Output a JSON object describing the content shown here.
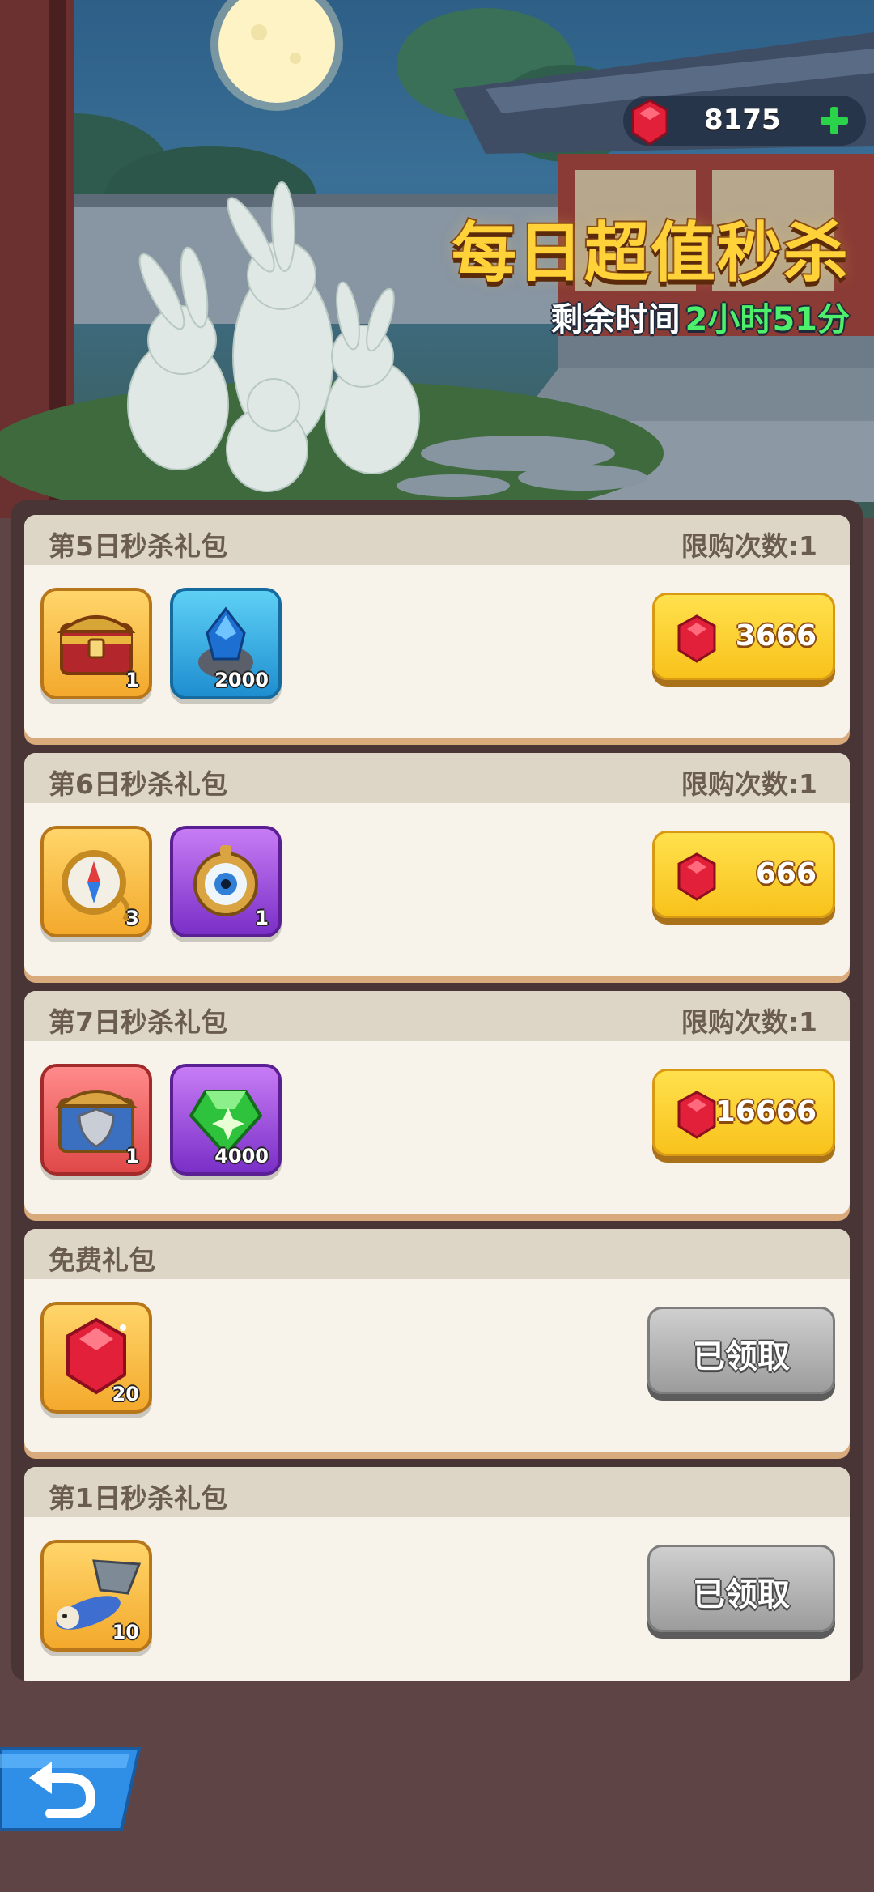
{
  "header": {
    "gem_balance": "8175",
    "title": "每日超值秒杀",
    "timer_label": "剩余时间",
    "timer_value": "2小时51分"
  },
  "colors": {
    "title_gold": "#ffd23a",
    "timer_green": "#4ef06b",
    "buy_yellow": "#f8c21b",
    "claimed_gray": "#9c9c9c",
    "background": "#5e4445"
  },
  "packs": [
    {
      "title": "第5日秒杀礼包",
      "limit": "限购次数:1",
      "items": [
        {
          "icon": "treasure-chest-icon",
          "qty": "1"
        },
        {
          "icon": "blue-crystal-pouch-icon",
          "qty": "2000"
        }
      ],
      "price": "3666",
      "status": "buy"
    },
    {
      "title": "第6日秒杀礼包",
      "limit": "限购次数:1",
      "items": [
        {
          "icon": "compass-icon",
          "qty": "3"
        },
        {
          "icon": "eye-amulet-icon",
          "qty": "1"
        }
      ],
      "price": "666",
      "status": "buy"
    },
    {
      "title": "第7日秒杀礼包",
      "limit": "限购次数:1",
      "items": [
        {
          "icon": "shield-chest-icon",
          "qty": "1"
        },
        {
          "icon": "green-gem-icon",
          "qty": "4000"
        }
      ],
      "price": "16666",
      "status": "buy"
    },
    {
      "title": "免费礼包",
      "items": [
        {
          "icon": "ruby-icon",
          "qty": "20"
        }
      ],
      "claimed_label": "已领取",
      "status": "claimed"
    },
    {
      "title": "第1日秒杀礼包",
      "items": [
        {
          "icon": "bucket-creature-icon",
          "qty": "10"
        }
      ],
      "claimed_label": "已领取",
      "status": "claimed"
    }
  ],
  "back_icon": "back-arrow-icon"
}
